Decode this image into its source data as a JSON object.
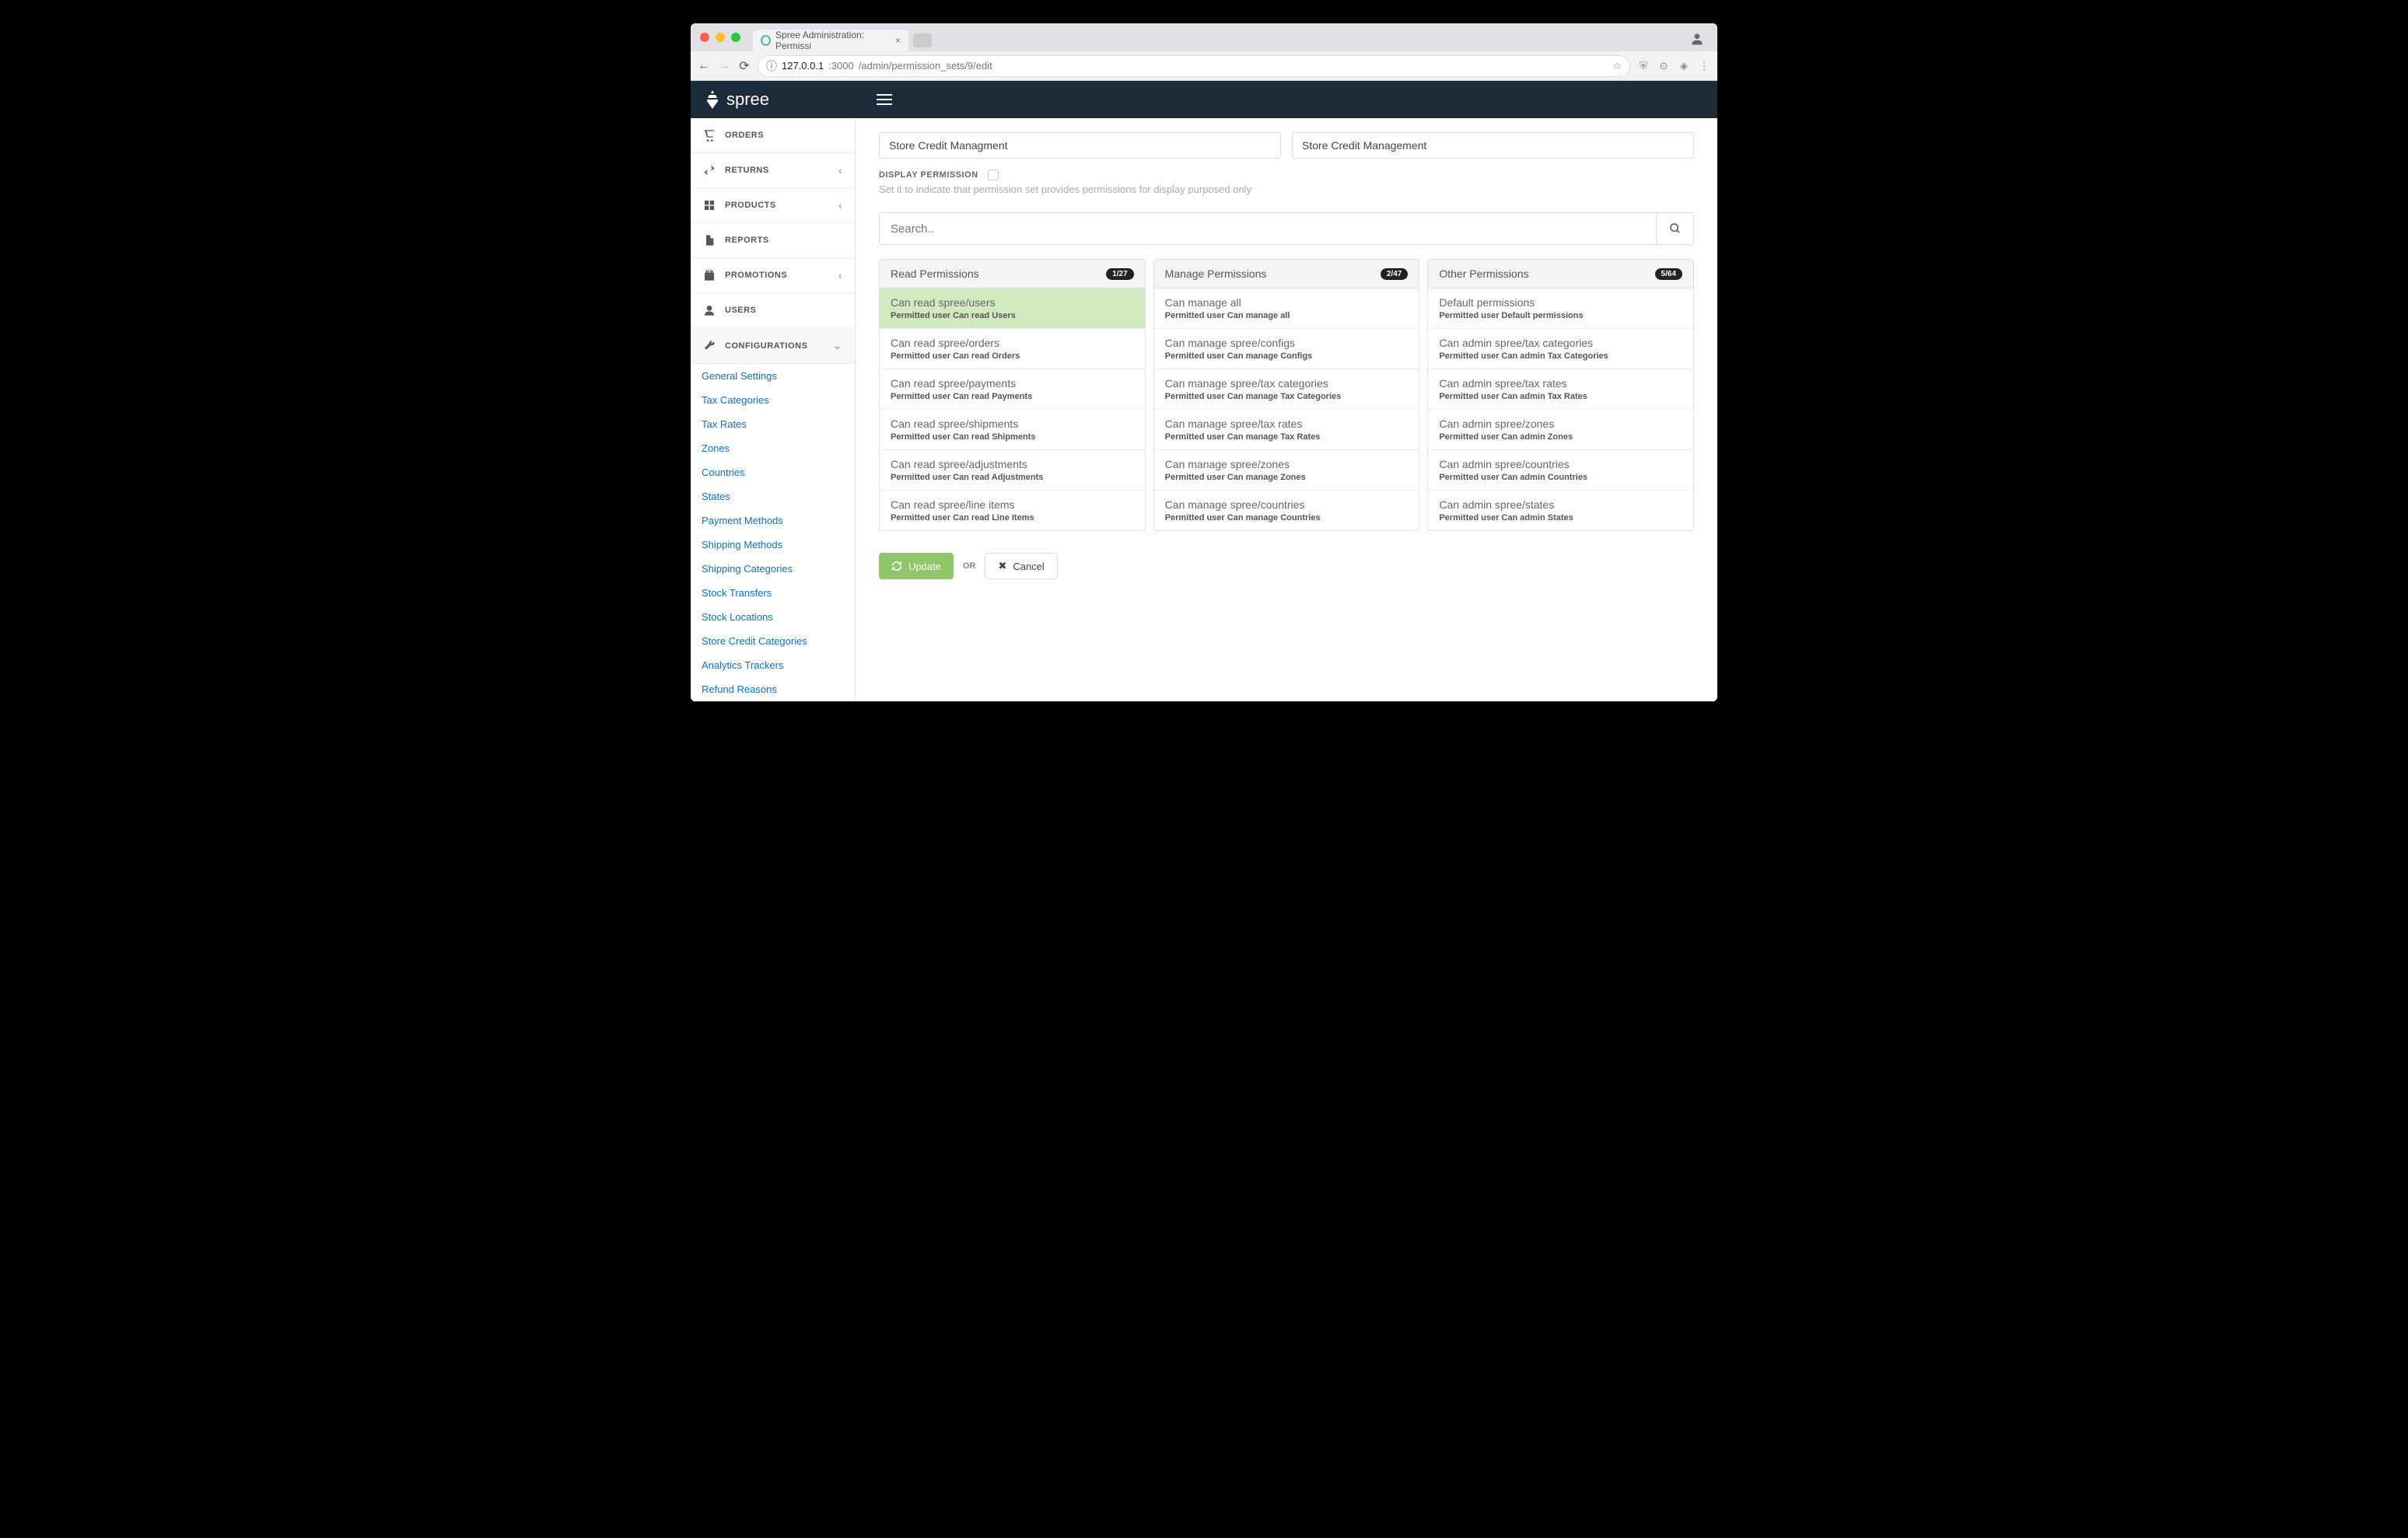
{
  "browser": {
    "tab_title": "Spree Administration: Permissi",
    "url_host": "127.0.0.1",
    "url_port": ":3000",
    "url_path": "/admin/permission_sets/9/edit"
  },
  "header": {
    "brand": "spree"
  },
  "sidebar": {
    "items": [
      {
        "label": "ORDERS",
        "icon": "cart"
      },
      {
        "label": "RETURNS",
        "icon": "swap",
        "chev": true
      },
      {
        "label": "PRODUCTS",
        "icon": "grid",
        "chev": true
      },
      {
        "label": "REPORTS",
        "icon": "doc"
      },
      {
        "label": "PROMOTIONS",
        "icon": "gift",
        "chev": true
      },
      {
        "label": "USERS",
        "icon": "user"
      },
      {
        "label": "CONFIGURATIONS",
        "icon": "wrench",
        "chev": true,
        "expanded": true
      }
    ],
    "subs": [
      "General Settings",
      "Tax Categories",
      "Tax Rates",
      "Zones",
      "Countries",
      "States",
      "Payment Methods",
      "Shipping Methods",
      "Shipping Categories",
      "Stock Transfers",
      "Stock Locations",
      "Store Credit Categories",
      "Analytics Trackers",
      "Refund Reasons"
    ]
  },
  "form": {
    "name_val": "Store Credit Managment",
    "display_val": "Store Credit Management",
    "chk_label": "DISPLAY PERMISSION",
    "hint": "Set it to indicate that permission set provides permissions for display purposed only",
    "search_placeholder": "Search..",
    "update_label": "Update",
    "or_label": "OR",
    "cancel_label": "Cancel"
  },
  "columns": [
    {
      "title": "Read Permissions",
      "badge": "1/27",
      "items": [
        {
          "t": "Can read spree/users",
          "d": "Permitted user Can read Users",
          "sel": true
        },
        {
          "t": "Can read spree/orders",
          "d": "Permitted user Can read Orders"
        },
        {
          "t": "Can read spree/payments",
          "d": "Permitted user Can read Payments"
        },
        {
          "t": "Can read spree/shipments",
          "d": "Permitted user Can read Shipments"
        },
        {
          "t": "Can read spree/adjustments",
          "d": "Permitted user Can read Adjustments"
        },
        {
          "t": "Can read spree/line items",
          "d": "Permitted user Can read Line Items"
        }
      ]
    },
    {
      "title": "Manage Permissions",
      "badge": "2/47",
      "items": [
        {
          "t": "Can manage all",
          "d": "Permitted user Can manage all"
        },
        {
          "t": "Can manage spree/configs",
          "d": "Permitted user Can manage Configs"
        },
        {
          "t": "Can manage spree/tax categories",
          "d": "Permitted user Can manage Tax Categories"
        },
        {
          "t": "Can manage spree/tax rates",
          "d": "Permitted user Can manage Tax Rates"
        },
        {
          "t": "Can manage spree/zones",
          "d": "Permitted user Can manage Zones"
        },
        {
          "t": "Can manage spree/countries",
          "d": "Permitted user Can manage Countries"
        }
      ]
    },
    {
      "title": "Other Permissions",
      "badge": "5/64",
      "items": [
        {
          "t": "Default permissions",
          "d": "Permitted user Default permissions"
        },
        {
          "t": "Can admin spree/tax categories",
          "d": "Permitted user Can admin Tax Categories"
        },
        {
          "t": "Can admin spree/tax rates",
          "d": "Permitted user Can admin Tax Rates"
        },
        {
          "t": "Can admin spree/zones",
          "d": "Permitted user Can admin Zones"
        },
        {
          "t": "Can admin spree/countries",
          "d": "Permitted user Can admin Countries"
        },
        {
          "t": "Can admin spree/states",
          "d": "Permitted user Can admin States"
        }
      ]
    }
  ]
}
